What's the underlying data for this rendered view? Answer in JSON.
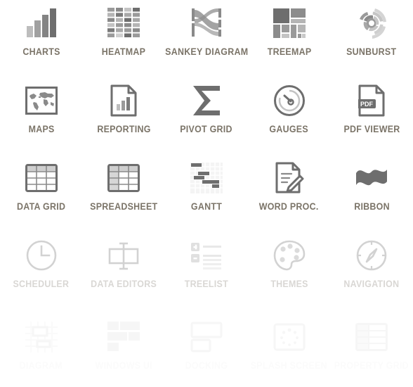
{
  "page": {
    "background": "#ffffff",
    "label_color": "#7b7468",
    "label_color_faded": "#d9d7d4",
    "label_color_ghost": "#fbfbfb",
    "icon_dark": "#6e6e6e",
    "icon_mid": "#8c8c8c",
    "icon_light": "#bdbdbd",
    "icon_pale": "#e4e4e4",
    "columns": 5
  },
  "items": [
    {
      "id": "charts",
      "label": "CHARTS",
      "icon": "bar-chart-icon",
      "state": "active"
    },
    {
      "id": "heatmap",
      "label": "HEATMAP",
      "icon": "heatmap-grid-icon",
      "state": "active"
    },
    {
      "id": "sankey",
      "label": "SANKEY DIAGRAM",
      "icon": "sankey-flow-icon",
      "state": "active"
    },
    {
      "id": "treemap",
      "label": "TREEMAP",
      "icon": "treemap-blocks-icon",
      "state": "active"
    },
    {
      "id": "sunburst",
      "label": "SUNBURST",
      "icon": "sunburst-rings-icon",
      "state": "active"
    },
    {
      "id": "maps",
      "label": "MAPS",
      "icon": "world-map-icon",
      "state": "active"
    },
    {
      "id": "reporting",
      "label": "REPORTING",
      "icon": "report-document-icon",
      "state": "active"
    },
    {
      "id": "pivot-grid",
      "label": "PIVOT GRID",
      "icon": "sigma-icon",
      "state": "active"
    },
    {
      "id": "gauges",
      "label": "GAUGES",
      "icon": "gauge-dial-icon",
      "state": "active"
    },
    {
      "id": "pdf-viewer",
      "label": "PDF VIEWER",
      "icon": "pdf-document-icon",
      "state": "active"
    },
    {
      "id": "data-grid",
      "label": "DATA GRID",
      "icon": "table-grid-icon",
      "state": "active"
    },
    {
      "id": "spreadsheet",
      "label": "SPREADSHEET",
      "icon": "spreadsheet-icon",
      "state": "active"
    },
    {
      "id": "gantt",
      "label": "GANTT",
      "icon": "gantt-chart-icon",
      "state": "active"
    },
    {
      "id": "word-proc",
      "label": "WORD PROC.",
      "icon": "document-pencil-icon",
      "state": "active"
    },
    {
      "id": "ribbon",
      "label": "RIBBON",
      "icon": "ribbon-banner-icon",
      "state": "active"
    },
    {
      "id": "scheduler",
      "label": "SCHEDULER",
      "icon": "clock-icon",
      "state": "faded"
    },
    {
      "id": "data-editors",
      "label": "DATA EDITORS",
      "icon": "editor-box-icon",
      "state": "faded"
    },
    {
      "id": "treelist",
      "label": "TREELIST",
      "icon": "treelist-icon",
      "state": "faded"
    },
    {
      "id": "themes",
      "label": "THEMES",
      "icon": "palette-icon",
      "state": "faded"
    },
    {
      "id": "navigation",
      "label": "NAVIGATION",
      "icon": "compass-icon",
      "state": "faded"
    },
    {
      "id": "diagram",
      "label": "DIAGRAM",
      "icon": "diagram-icon",
      "state": "ghost"
    },
    {
      "id": "windows-ui",
      "label": "WINDOWS UI",
      "icon": "tiles-icon",
      "state": "ghost"
    },
    {
      "id": "docking",
      "label": "DOCKING",
      "icon": "docking-panels-icon",
      "state": "ghost"
    },
    {
      "id": "splash-screen",
      "label": "SPLASH SCREEN",
      "icon": "spinner-icon",
      "state": "ghost"
    },
    {
      "id": "property-grid",
      "label": "PROPERTY GRID",
      "icon": "property-rows-icon",
      "state": "ghost"
    }
  ]
}
